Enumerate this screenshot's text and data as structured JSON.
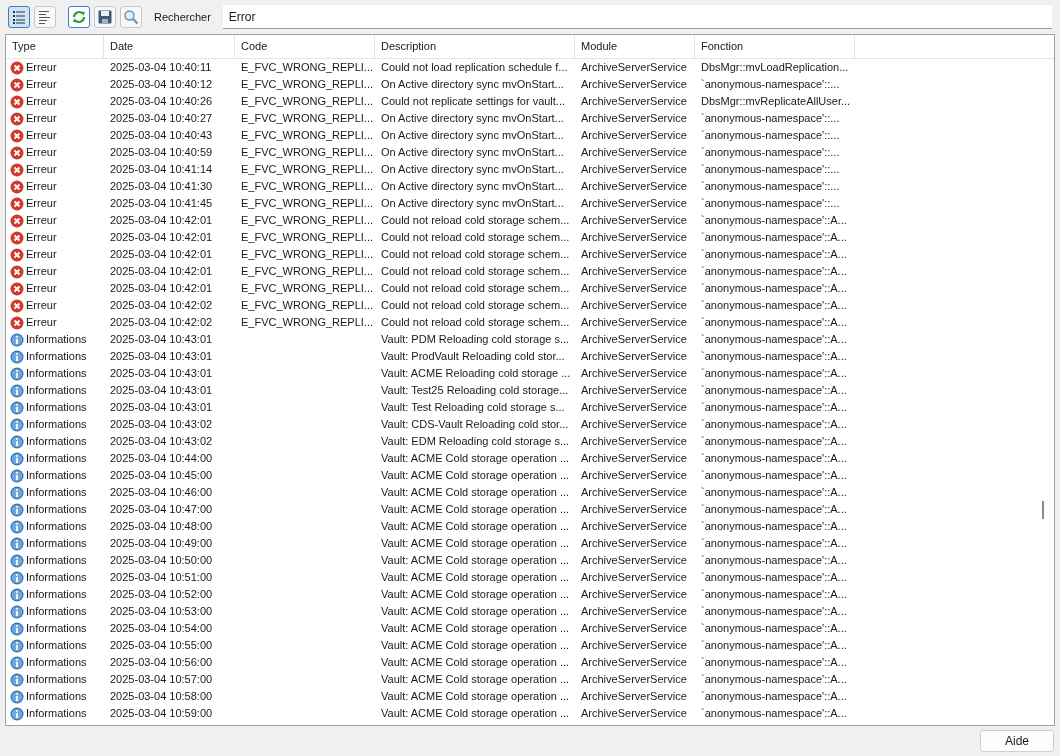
{
  "toolbar": {
    "view_buttons": [
      {
        "kind": "list",
        "selected": true
      },
      {
        "kind": "detail",
        "selected": false
      }
    ],
    "search_label": "Rechercher",
    "search_value": "Error"
  },
  "table": {
    "columns": [
      "Type",
      "Date",
      "Code",
      "Description",
      "Module",
      "Fonction"
    ],
    "rows": [
      {
        "kind": "error",
        "type": "Erreur",
        "date": "2025-03-04 10:40:11",
        "code": "E_FVC_WRONG_REPLI...",
        "description": "Could not load replication schedule f...",
        "module": "ArchiveServerService",
        "function": "DbsMgr::mvLoadReplication..."
      },
      {
        "kind": "error",
        "type": "Erreur",
        "date": "2025-03-04 10:40:12",
        "code": "E_FVC_WRONG_REPLI...",
        "description": "On Active directory sync mvOnStart...",
        "module": "ArchiveServerService",
        "function": "`anonymous-namespace'::..."
      },
      {
        "kind": "error",
        "type": "Erreur",
        "date": "2025-03-04 10:40:26",
        "code": "E_FVC_WRONG_REPLI...",
        "description": "Could not replicate settings for vault...",
        "module": "ArchiveServerService",
        "function": "DbsMgr::mvReplicateAllUser..."
      },
      {
        "kind": "error",
        "type": "Erreur",
        "date": "2025-03-04 10:40:27",
        "code": "E_FVC_WRONG_REPLI...",
        "description": "On Active directory sync mvOnStart...",
        "module": "ArchiveServerService",
        "function": "`anonymous-namespace'::..."
      },
      {
        "kind": "error",
        "type": "Erreur",
        "date": "2025-03-04 10:40:43",
        "code": "E_FVC_WRONG_REPLI...",
        "description": "On Active directory sync mvOnStart...",
        "module": "ArchiveServerService",
        "function": "`anonymous-namespace'::..."
      },
      {
        "kind": "error",
        "type": "Erreur",
        "date": "2025-03-04 10:40:59",
        "code": "E_FVC_WRONG_REPLI...",
        "description": "On Active directory sync mvOnStart...",
        "module": "ArchiveServerService",
        "function": "`anonymous-namespace'::..."
      },
      {
        "kind": "error",
        "type": "Erreur",
        "date": "2025-03-04 10:41:14",
        "code": "E_FVC_WRONG_REPLI...",
        "description": "On Active directory sync mvOnStart...",
        "module": "ArchiveServerService",
        "function": "`anonymous-namespace'::..."
      },
      {
        "kind": "error",
        "type": "Erreur",
        "date": "2025-03-04 10:41:30",
        "code": "E_FVC_WRONG_REPLI...",
        "description": "On Active directory sync mvOnStart...",
        "module": "ArchiveServerService",
        "function": "`anonymous-namespace'::..."
      },
      {
        "kind": "error",
        "type": "Erreur",
        "date": "2025-03-04 10:41:45",
        "code": "E_FVC_WRONG_REPLI...",
        "description": "On Active directory sync mvOnStart...",
        "module": "ArchiveServerService",
        "function": "`anonymous-namespace'::..."
      },
      {
        "kind": "error",
        "type": "Erreur",
        "date": "2025-03-04 10:42:01",
        "code": "E_FVC_WRONG_REPLI...",
        "description": "Could not reload cold storage schem...",
        "module": "ArchiveServerService",
        "function": "`anonymous-namespace'::A..."
      },
      {
        "kind": "error",
        "type": "Erreur",
        "date": "2025-03-04 10:42:01",
        "code": "E_FVC_WRONG_REPLI...",
        "description": "Could not reload cold storage schem...",
        "module": "ArchiveServerService",
        "function": "`anonymous-namespace'::A..."
      },
      {
        "kind": "error",
        "type": "Erreur",
        "date": "2025-03-04 10:42:01",
        "code": "E_FVC_WRONG_REPLI...",
        "description": "Could not reload cold storage schem...",
        "module": "ArchiveServerService",
        "function": "`anonymous-namespace'::A..."
      },
      {
        "kind": "error",
        "type": "Erreur",
        "date": "2025-03-04 10:42:01",
        "code": "E_FVC_WRONG_REPLI...",
        "description": "Could not reload cold storage schem...",
        "module": "ArchiveServerService",
        "function": "`anonymous-namespace'::A..."
      },
      {
        "kind": "error",
        "type": "Erreur",
        "date": "2025-03-04 10:42:01",
        "code": "E_FVC_WRONG_REPLI...",
        "description": "Could not reload cold storage schem...",
        "module": "ArchiveServerService",
        "function": "`anonymous-namespace'::A..."
      },
      {
        "kind": "error",
        "type": "Erreur",
        "date": "2025-03-04 10:42:02",
        "code": "E_FVC_WRONG_REPLI...",
        "description": "Could not reload cold storage schem...",
        "module": "ArchiveServerService",
        "function": "`anonymous-namespace'::A..."
      },
      {
        "kind": "error",
        "type": "Erreur",
        "date": "2025-03-04 10:42:02",
        "code": "E_FVC_WRONG_REPLI...",
        "description": "Could not reload cold storage schem...",
        "module": "ArchiveServerService",
        "function": "`anonymous-namespace'::A..."
      },
      {
        "kind": "info",
        "type": "Informations",
        "date": "2025-03-04 10:43:01",
        "description": "Vault: PDM Reloading cold storage s...",
        "module": "ArchiveServerService",
        "function": "`anonymous-namespace'::A..."
      },
      {
        "kind": "info",
        "type": "Informations",
        "date": "2025-03-04 10:43:01",
        "description": "Vault: ProdVault Reloading cold stor...",
        "module": "ArchiveServerService",
        "function": "`anonymous-namespace'::A..."
      },
      {
        "kind": "info",
        "type": "Informations",
        "date": "2025-03-04 10:43:01",
        "description": "Vault: ACME Reloading cold storage ...",
        "module": "ArchiveServerService",
        "function": "`anonymous-namespace'::A..."
      },
      {
        "kind": "info",
        "type": "Informations",
        "date": "2025-03-04 10:43:01",
        "description": "Vault: Test25 Reloading cold storage...",
        "module": "ArchiveServerService",
        "function": "`anonymous-namespace'::A..."
      },
      {
        "kind": "info",
        "type": "Informations",
        "date": "2025-03-04 10:43:01",
        "description": "Vault: Test Reloading cold storage s...",
        "module": "ArchiveServerService",
        "function": "`anonymous-namespace'::A..."
      },
      {
        "kind": "info",
        "type": "Informations",
        "date": "2025-03-04 10:43:02",
        "description": "Vault: CDS-Vault Reloading cold stor...",
        "module": "ArchiveServerService",
        "function": "`anonymous-namespace'::A..."
      },
      {
        "kind": "info",
        "type": "Informations",
        "date": "2025-03-04 10:43:02",
        "description": "Vault: EDM Reloading cold storage s...",
        "module": "ArchiveServerService",
        "function": "`anonymous-namespace'::A..."
      },
      {
        "kind": "info",
        "type": "Informations",
        "date": "2025-03-04 10:44:00",
        "description": "Vault: ACME Cold storage operation ...",
        "module": "ArchiveServerService",
        "function": "`anonymous-namespace'::A..."
      },
      {
        "kind": "info",
        "type": "Informations",
        "date": "2025-03-04 10:45:00",
        "description": "Vault: ACME Cold storage operation ...",
        "module": "ArchiveServerService",
        "function": "`anonymous-namespace'::A..."
      },
      {
        "kind": "info",
        "type": "Informations",
        "date": "2025-03-04 10:46:00",
        "description": "Vault: ACME Cold storage operation ...",
        "module": "ArchiveServerService",
        "function": "`anonymous-namespace'::A..."
      },
      {
        "kind": "info",
        "type": "Informations",
        "date": "2025-03-04 10:47:00",
        "description": "Vault: ACME Cold storage operation ...",
        "module": "ArchiveServerService",
        "function": "`anonymous-namespace'::A..."
      },
      {
        "kind": "info",
        "type": "Informations",
        "date": "2025-03-04 10:48:00",
        "description": "Vault: ACME Cold storage operation ...",
        "module": "ArchiveServerService",
        "function": "`anonymous-namespace'::A..."
      },
      {
        "kind": "info",
        "type": "Informations",
        "date": "2025-03-04 10:49:00",
        "description": "Vault: ACME Cold storage operation ...",
        "module": "ArchiveServerService",
        "function": "`anonymous-namespace'::A..."
      },
      {
        "kind": "info",
        "type": "Informations",
        "date": "2025-03-04 10:50:00",
        "description": "Vault: ACME Cold storage operation ...",
        "module": "ArchiveServerService",
        "function": "`anonymous-namespace'::A..."
      },
      {
        "kind": "info",
        "type": "Informations",
        "date": "2025-03-04 10:51:00",
        "description": "Vault: ACME Cold storage operation ...",
        "module": "ArchiveServerService",
        "function": "`anonymous-namespace'::A..."
      },
      {
        "kind": "info",
        "type": "Informations",
        "date": "2025-03-04 10:52:00",
        "description": "Vault: ACME Cold storage operation ...",
        "module": "ArchiveServerService",
        "function": "`anonymous-namespace'::A..."
      },
      {
        "kind": "info",
        "type": "Informations",
        "date": "2025-03-04 10:53:00",
        "description": "Vault: ACME Cold storage operation ...",
        "module": "ArchiveServerService",
        "function": "`anonymous-namespace'::A..."
      },
      {
        "kind": "info",
        "type": "Informations",
        "date": "2025-03-04 10:54:00",
        "description": "Vault: ACME Cold storage operation ...",
        "module": "ArchiveServerService",
        "function": "`anonymous-namespace'::A..."
      },
      {
        "kind": "info",
        "type": "Informations",
        "date": "2025-03-04 10:55:00",
        "description": "Vault: ACME Cold storage operation ...",
        "module": "ArchiveServerService",
        "function": "`anonymous-namespace'::A..."
      },
      {
        "kind": "info",
        "type": "Informations",
        "date": "2025-03-04 10:56:00",
        "description": "Vault: ACME Cold storage operation ...",
        "module": "ArchiveServerService",
        "function": "`anonymous-namespace'::A..."
      },
      {
        "kind": "info",
        "type": "Informations",
        "date": "2025-03-04 10:57:00",
        "description": "Vault: ACME Cold storage operation ...",
        "module": "ArchiveServerService",
        "function": "`anonymous-namespace'::A..."
      },
      {
        "kind": "info",
        "type": "Informations",
        "date": "2025-03-04 10:58:00",
        "description": "Vault: ACME Cold storage operation ...",
        "module": "ArchiveServerService",
        "function": "`anonymous-namespace'::A..."
      },
      {
        "kind": "info",
        "type": "Informations",
        "date": "2025-03-04 10:59:00",
        "description": "Vault: ACME Cold storage operation ...",
        "module": "ArchiveServerService",
        "function": "`anonymous-namespace'::A..."
      }
    ]
  },
  "help_button": "Aide"
}
